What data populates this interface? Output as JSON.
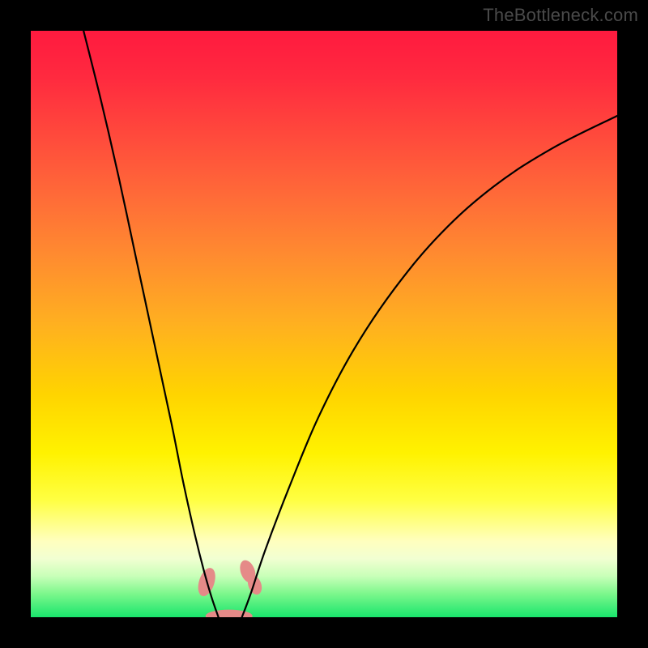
{
  "watermark": "TheBottleneck.com",
  "chart_data": {
    "type": "line",
    "title": "",
    "xlabel": "",
    "ylabel": "",
    "background_gradient": [
      "#ff1a3f",
      "#ff6a38",
      "#ffd400",
      "#ffff42",
      "#19e56c"
    ],
    "series": [
      {
        "name": "left-curve",
        "points": [
          {
            "x": 0.09,
            "y": 1.0
          },
          {
            "x": 0.12,
            "y": 0.88
          },
          {
            "x": 0.15,
            "y": 0.75
          },
          {
            "x": 0.18,
            "y": 0.61
          },
          {
            "x": 0.21,
            "y": 0.47
          },
          {
            "x": 0.24,
            "y": 0.33
          },
          {
            "x": 0.26,
            "y": 0.23
          },
          {
            "x": 0.28,
            "y": 0.14
          },
          {
            "x": 0.295,
            "y": 0.08
          },
          {
            "x": 0.308,
            "y": 0.035
          },
          {
            "x": 0.32,
            "y": 0.0
          }
        ]
      },
      {
        "name": "right-curve",
        "points": [
          {
            "x": 0.36,
            "y": 0.0
          },
          {
            "x": 0.375,
            "y": 0.04
          },
          {
            "x": 0.4,
            "y": 0.115
          },
          {
            "x": 0.44,
            "y": 0.22
          },
          {
            "x": 0.49,
            "y": 0.34
          },
          {
            "x": 0.55,
            "y": 0.455
          },
          {
            "x": 0.62,
            "y": 0.56
          },
          {
            "x": 0.7,
            "y": 0.655
          },
          {
            "x": 0.79,
            "y": 0.735
          },
          {
            "x": 0.89,
            "y": 0.8
          },
          {
            "x": 1.0,
            "y": 0.855
          }
        ]
      }
    ],
    "markers": [
      {
        "name": "left-top-blob",
        "cx": 0.3,
        "cy": 0.06,
        "rx": 0.013,
        "ry": 0.025,
        "rot": 18
      },
      {
        "name": "right-top-blob-1",
        "cx": 0.37,
        "cy": 0.078,
        "rx": 0.012,
        "ry": 0.02,
        "rot": -20
      },
      {
        "name": "right-top-blob-2",
        "cx": 0.382,
        "cy": 0.055,
        "rx": 0.011,
        "ry": 0.017,
        "rot": -20
      },
      {
        "name": "bottom-blob",
        "cx": 0.338,
        "cy": 0.002,
        "rx": 0.04,
        "ry": 0.011,
        "rot": 0
      }
    ],
    "xlim": [
      0,
      1
    ],
    "ylim": [
      0,
      1
    ]
  }
}
